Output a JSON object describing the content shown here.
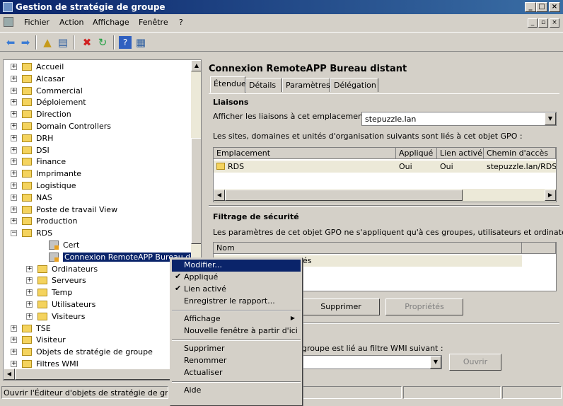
{
  "window": {
    "title": "Gestion de stratégie de groupe",
    "controls": [
      "_",
      "□",
      "×"
    ]
  },
  "menubar": {
    "items": [
      "Fichier",
      "Action",
      "Affichage",
      "Fenêtre",
      "?"
    ],
    "mdi_controls": [
      "_",
      "▫",
      "×"
    ]
  },
  "toolbar": {
    "icons": [
      "back-icon",
      "forward-icon",
      "up-folder-icon",
      "show-hide-tree-icon",
      "delete-icon",
      "refresh-icon",
      "help-icon",
      "properties-icon"
    ]
  },
  "tree": {
    "items": [
      {
        "label": "Accueil",
        "type": "folder",
        "level": 1,
        "expander": "+"
      },
      {
        "label": "Alcasar",
        "type": "folder",
        "level": 1,
        "expander": "+"
      },
      {
        "label": "Commercial",
        "type": "folder",
        "level": 1,
        "expander": "+"
      },
      {
        "label": "Déploiement",
        "type": "folder",
        "level": 1,
        "expander": "+"
      },
      {
        "label": "Direction",
        "type": "folder",
        "level": 1,
        "expander": "+"
      },
      {
        "label": "Domain Controllers",
        "type": "folder",
        "level": 1,
        "expander": "+"
      },
      {
        "label": "DRH",
        "type": "folder",
        "level": 1,
        "expander": "+"
      },
      {
        "label": "DSI",
        "type": "folder",
        "level": 1,
        "expander": "+"
      },
      {
        "label": "Finance",
        "type": "folder",
        "level": 1,
        "expander": "+"
      },
      {
        "label": "Imprimante",
        "type": "folder",
        "level": 1,
        "expander": "+"
      },
      {
        "label": "Logistique",
        "type": "folder",
        "level": 1,
        "expander": "+"
      },
      {
        "label": "NAS",
        "type": "folder",
        "level": 1,
        "expander": "+"
      },
      {
        "label": "Poste de travail View",
        "type": "folder",
        "level": 1,
        "expander": "+"
      },
      {
        "label": "Production",
        "type": "folder",
        "level": 1,
        "expander": "+"
      },
      {
        "label": "RDS",
        "type": "folder",
        "level": 1,
        "expander": "−"
      },
      {
        "label": "Cert",
        "type": "gpo",
        "level": 2,
        "expander": ""
      },
      {
        "label": "Connexion RemoteAPP Bureau dist",
        "type": "gpo",
        "level": 2,
        "expander": "",
        "selected": true
      },
      {
        "label": "Ordinateurs",
        "type": "folder",
        "level": 2,
        "expander": "+"
      },
      {
        "label": "Serveurs",
        "type": "folder",
        "level": 2,
        "expander": "+"
      },
      {
        "label": "Temp",
        "type": "folder",
        "level": 2,
        "expander": "+"
      },
      {
        "label": "Utilisateurs",
        "type": "folder",
        "level": 2,
        "expander": "+"
      },
      {
        "label": "Visiteurs",
        "type": "folder",
        "level": 2,
        "expander": "+"
      },
      {
        "label": "TSE",
        "type": "folder",
        "level": 1,
        "expander": "+"
      },
      {
        "label": "Visiteur",
        "type": "folder",
        "level": 1,
        "expander": "+"
      },
      {
        "label": "Objets de stratégie de groupe",
        "type": "folder",
        "level": 1,
        "expander": "+"
      },
      {
        "label": "Filtres WMI",
        "type": "folder",
        "level": 1,
        "expander": "+"
      }
    ]
  },
  "details": {
    "title": "Connexion RemoteAPP Bureau distant",
    "tabs": [
      "Étendue",
      "Détails",
      "Paramètres",
      "Délégation"
    ],
    "active_tab": "Étendue",
    "links": {
      "heading": "Liaisons",
      "location_label": "Afficher les liaisons à cet emplacement :",
      "location_value": "stepuzzle.lan",
      "description": "Les sites, domaines et unités d'organisation suivants sont liés à cet objet GPO :",
      "columns": [
        "Emplacement",
        "Appliqué",
        "Lien activé",
        "Chemin d'accès"
      ],
      "rows": [
        {
          "location": "RDS",
          "enforced": "Oui",
          "enabled": "Oui",
          "path": "stepuzzle.lan/RDS"
        }
      ]
    },
    "security": {
      "heading": "Filtrage de sécurité",
      "description": "Les paramètres de cet objet GPO ne s'appliquent qu'à ces groupes, utilisateurs et ordinateurs :",
      "column": "Nom",
      "row_partial": "és",
      "buttons": {
        "delete": "Supprimer",
        "properties": "Propriétés"
      }
    },
    "wmi": {
      "description_partial": "groupe est lié au filtre WMI suivant :",
      "open_button": "Ouvrir"
    }
  },
  "statusbar": {
    "text": "Ouvrir l'Éditeur d'objets de stratégie de group"
  },
  "context_menu": {
    "items": [
      {
        "label": "Modifier...",
        "highlighted": true
      },
      {
        "label": "Appliqué",
        "checked": true
      },
      {
        "label": "Lien activé",
        "checked": true
      },
      {
        "label": "Enregistrer le rapport..."
      },
      {
        "separator": true
      },
      {
        "label": "Affichage",
        "submenu": true
      },
      {
        "label": "Nouvelle fenêtre à partir d'ici"
      },
      {
        "separator": true
      },
      {
        "label": "Supprimer"
      },
      {
        "label": "Renommer"
      },
      {
        "label": "Actualiser"
      },
      {
        "separator": true
      },
      {
        "label": "Aide"
      }
    ]
  }
}
